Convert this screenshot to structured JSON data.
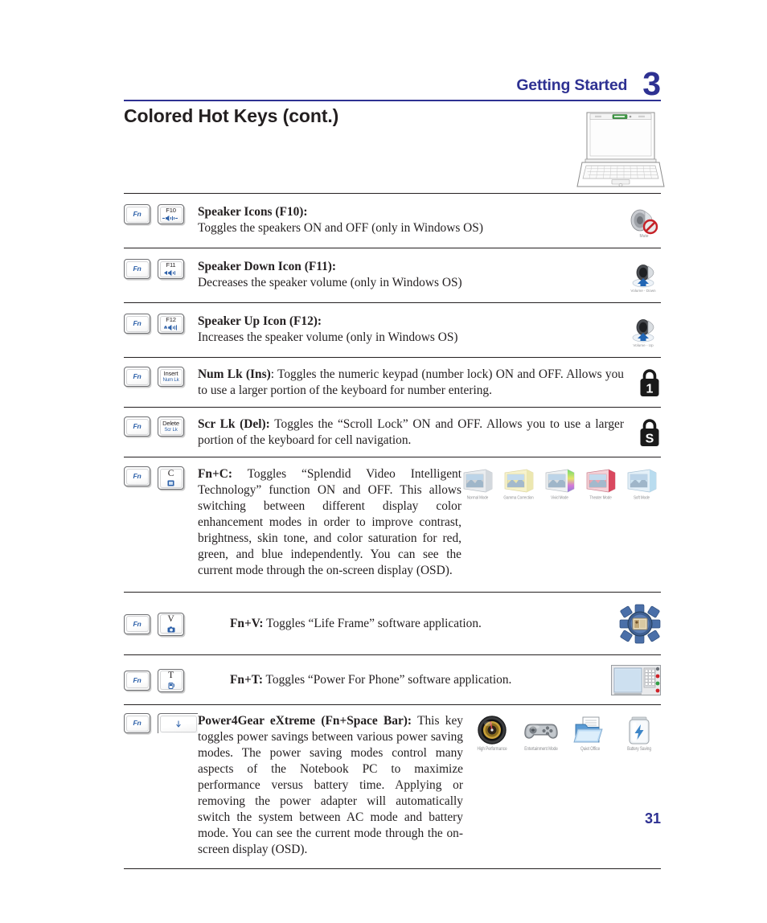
{
  "header": {
    "title": "Getting Started",
    "chapter": "3"
  },
  "page_title": "Colored Hot Keys (cont.)",
  "page_number": "31",
  "colors": {
    "accent_blue": "#2e3192",
    "key_label_blue": "#2b5fa8",
    "text": "#231f20",
    "rule": "#231f20",
    "highlight_red": "#ed1c24"
  },
  "figure": {
    "name": "notebook-illustration",
    "caption": "",
    "highlight": "keyboard function-key row highlighted in red"
  },
  "rows": [
    {
      "id": "speaker-icons",
      "keys": [
        {
          "top": "Fn",
          "style": "blue",
          "sub": "",
          "icon": ""
        },
        {
          "top": "F10",
          "style": "plain",
          "sub": "",
          "icon": "speaker-mute"
        }
      ],
      "title": "Speaker Icons (F10):",
      "body": "Toggles the speakers ON and OFF (only in Windows OS)",
      "right_icon": "speaker-mute-icon",
      "right_icon_label": "Mute"
    },
    {
      "id": "speaker-down",
      "keys": [
        {
          "top": "Fn",
          "style": "blue",
          "sub": "",
          "icon": ""
        },
        {
          "top": "F11",
          "style": "plain",
          "sub": "",
          "icon": "volume-down"
        }
      ],
      "title": "Speaker Down Icon (F11):",
      "body": "Decreases the speaker volume (only in Windows OS)",
      "right_icon": "volume-down-icon",
      "right_icon_label": "Volume - Down"
    },
    {
      "id": "speaker-up",
      "keys": [
        {
          "top": "Fn",
          "style": "blue",
          "sub": "",
          "icon": ""
        },
        {
          "top": "F12",
          "style": "plain",
          "sub": "",
          "icon": "volume-up"
        }
      ],
      "title": "Speaker Up Icon (F12):",
      "body": "Increases the speaker volume (only in Windows OS)",
      "right_icon": "volume-up-icon",
      "right_icon_label": "Volume - Up"
    },
    {
      "id": "num-lock",
      "keys": [
        {
          "top": "Fn",
          "style": "blue",
          "sub": "",
          "icon": ""
        },
        {
          "top": "Insert",
          "style": "plain",
          "sub": "Num Lk",
          "icon": ""
        }
      ],
      "title": "Num Lk (Ins)",
      "body": ": Toggles the numeric keypad (number lock) ON and OFF. Allows you to use a larger portion of the keyboard for number entering.",
      "right_icon": "padlock-numlock-icon",
      "right_icon_label": "1"
    },
    {
      "id": "scroll-lock",
      "keys": [
        {
          "top": "Fn",
          "style": "blue",
          "sub": "",
          "icon": ""
        },
        {
          "top": "Delete",
          "style": "plain",
          "sub": "Scr Lk",
          "icon": ""
        }
      ],
      "title": "Scr Lk (Del):",
      "body": " Toggles the “Scroll Lock” ON and OFF. Allows you to use a larger portion of the keyboard for cell navigation.",
      "right_icon": "padlock-scrolllock-icon",
      "right_icon_label": "S"
    },
    {
      "id": "fn-c-splendid",
      "keys": [
        {
          "top": "C",
          "style": "big-second",
          "sub": "",
          "icon": "splendid"
        }
      ],
      "title": "Fn+C:",
      "body": " Toggles “Splendid Video Intelligent Technology” function ON and OFF. This allows switching between different display color enhancement modes in order to improve contrast, brightness, skin tone, and color saturation for red, green, and blue independently. You can see the current mode through the on-screen display (OSD).",
      "right_icon": "splendid-modes-strip"
    },
    {
      "id": "fn-v-life-frame",
      "keys": [
        {
          "top": "V",
          "style": "big-second",
          "sub": "",
          "icon": "camera"
        }
      ],
      "title": "Fn+V:",
      "body": " Toggles “Life Frame” software application.",
      "right_icon": "life-frame-icon"
    },
    {
      "id": "fn-t-power-for-phone",
      "keys": [
        {
          "top": "T",
          "style": "big-second",
          "sub": "",
          "icon": "phone"
        }
      ],
      "title": "Fn+T:",
      "body": " Toggles “Power For Phone” software application.",
      "right_icon": "power-for-phone-icon"
    },
    {
      "id": "power4gear-extreme",
      "keys": [
        {
          "top": "",
          "style": "spacebar",
          "sub": "",
          "icon": "spacebar"
        }
      ],
      "title": "Power4Gear eXtreme (Fn+Space Bar):",
      "body": " This key toggles power savings between various power saving modes. The power saving modes control many aspects of the Notebook PC to maximize performance versus battery time. Applying or removing the power adapter will automatically switch the system between AC mode and battery mode. You can see the current mode through the on-screen display (OSD).",
      "right_icon": "power4gear-modes-strip"
    }
  ],
  "splendid_modes": [
    {
      "label": "Normal Mode",
      "color": "#cfd4d8"
    },
    {
      "label": "Gamma Correction",
      "color": "#ece7b0"
    },
    {
      "label": "Vivid Mode",
      "color": "#b8e0a8"
    },
    {
      "label": "Theater Mode",
      "color": "#e06a82"
    },
    {
      "label": "Soft Mode",
      "color": "#b9dcef"
    }
  ],
  "power_modes": [
    {
      "label": "High Performance",
      "icon": "gauge-icon"
    },
    {
      "label": "Entertainment Mode",
      "icon": "gamepad-icon"
    },
    {
      "label": "Quiet Office",
      "icon": "folder-icon"
    },
    {
      "label": "Battery Saving",
      "icon": "battery-icon"
    }
  ]
}
